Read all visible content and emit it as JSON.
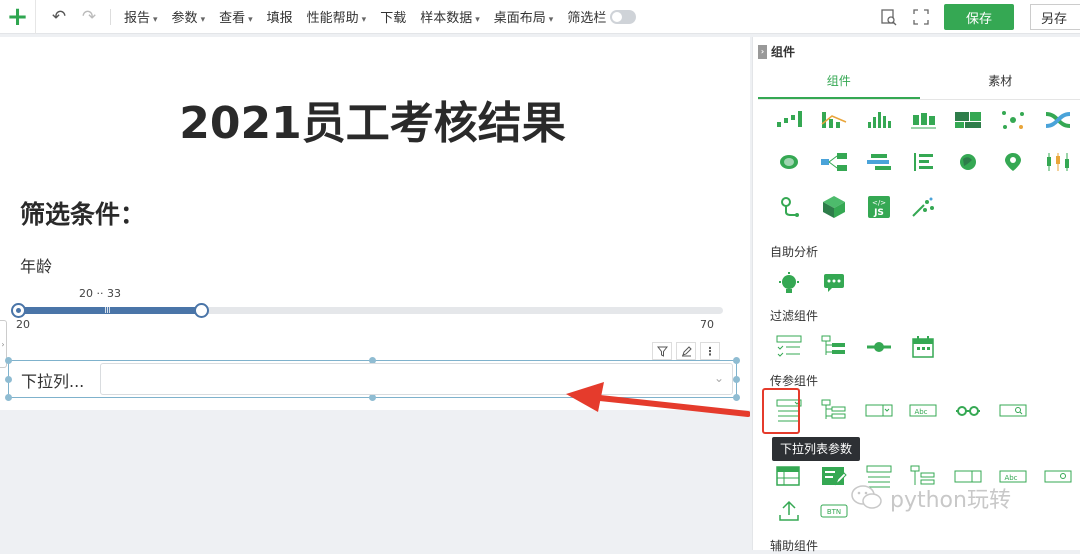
{
  "toolbar": {
    "menus": [
      "报告",
      "参数",
      "查看",
      "填报",
      "性能帮助",
      "下载",
      "样本数据",
      "桌面布局",
      "筛选栏"
    ],
    "save_label": "保存",
    "save_as_label": "另存"
  },
  "report": {
    "title": "2021员工考核结果",
    "filter_heading": "筛选条件：",
    "age_label": "年龄",
    "range_readout": "20  ··  33",
    "slider": {
      "min": 20,
      "max": 70,
      "low": 20,
      "high": 33
    },
    "dropdown_label": "下拉列..."
  },
  "panel": {
    "header": "组件",
    "tabs": [
      "组件",
      "素材"
    ],
    "sections": {
      "self_analysis": "自助分析",
      "filter": "过滤组件",
      "param": "传参组件",
      "assist": "辅助组件"
    },
    "tooltip": "下拉列表参数",
    "btn_icon_text": "BTN",
    "abc_text": "Abc"
  },
  "watermark": "python玩转",
  "colors": {
    "accent": "#35a853",
    "slider": "#4a75a8",
    "highlight": "#e53b2c"
  }
}
